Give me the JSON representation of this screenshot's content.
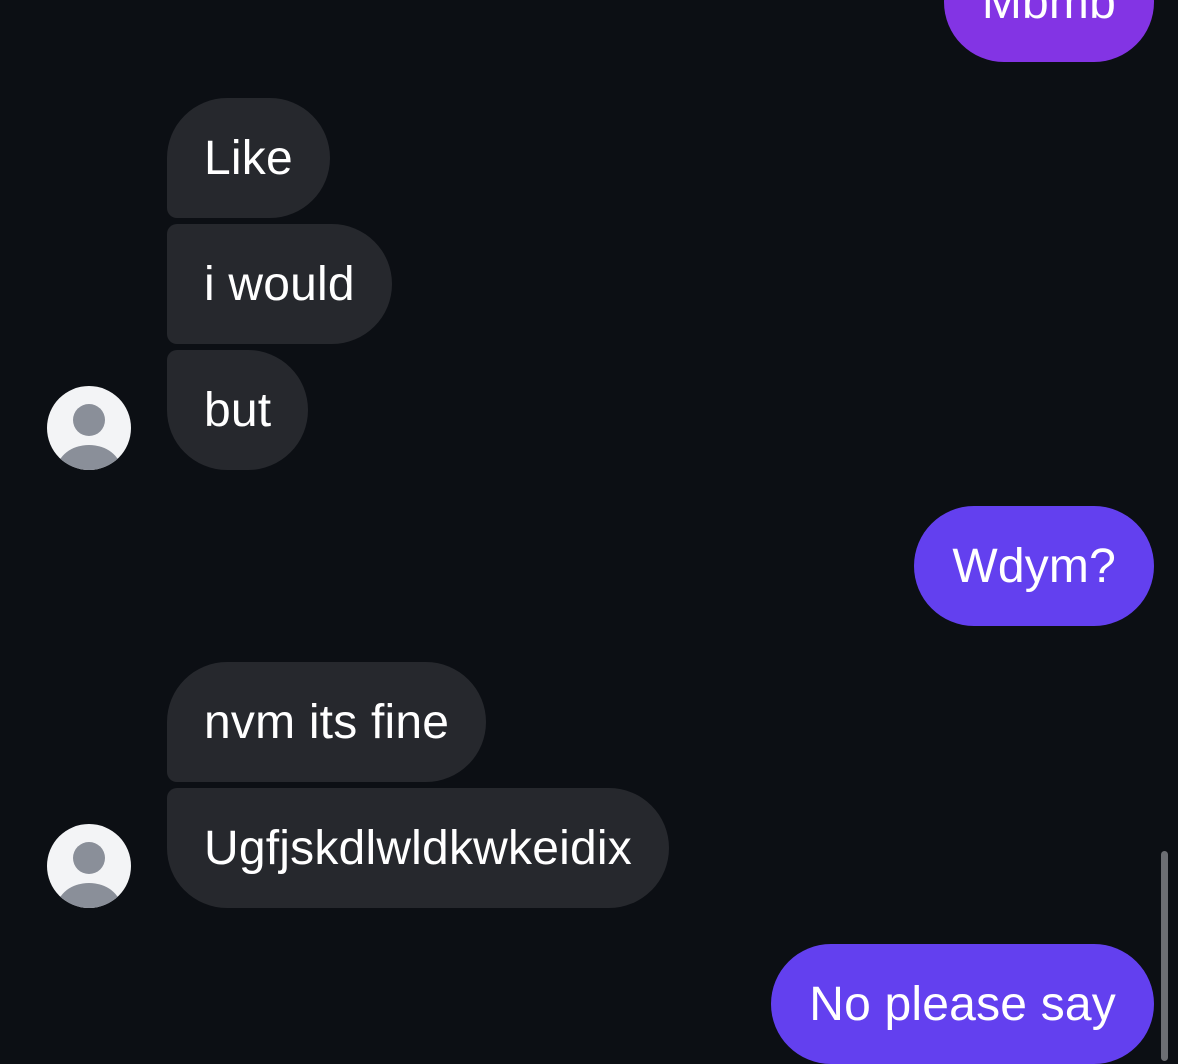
{
  "conversation": {
    "messages": [
      {
        "sender": "me",
        "text": "Mbmb",
        "color": "#8334e4"
      },
      {
        "sender": "them",
        "text": "Like"
      },
      {
        "sender": "them",
        "text": "i would"
      },
      {
        "sender": "them",
        "text": "but"
      },
      {
        "sender": "me",
        "text": "Wdym?",
        "color": "#6340ef"
      },
      {
        "sender": "them",
        "text": "nvm its fine"
      },
      {
        "sender": "them",
        "text": "Ugfjskdlwldkwkeidix"
      },
      {
        "sender": "me",
        "text": "No please say",
        "color": "#6340ef"
      }
    ]
  },
  "theme": {
    "background": "#0c0f14",
    "incoming_bubble": "#26282d",
    "outgoing_bubble_violet": "#8334e4",
    "outgoing_bubble_blue": "#6340ef",
    "avatar_icon": "default-user-avatar-icon"
  }
}
